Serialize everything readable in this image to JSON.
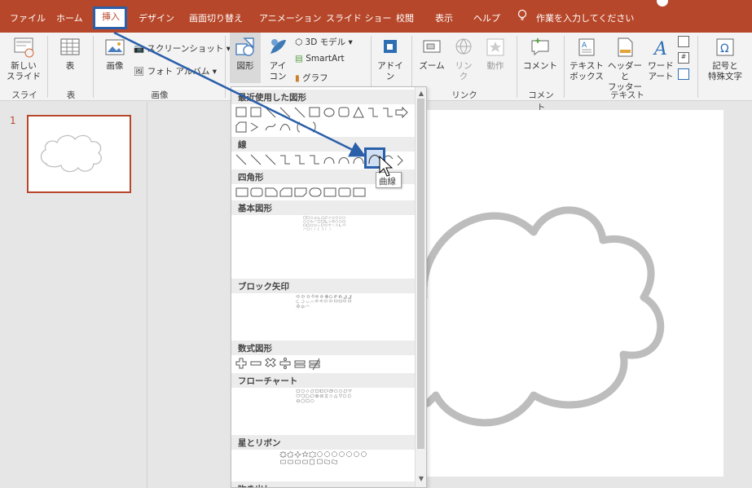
{
  "tabs": [
    {
      "label": "ファイル"
    },
    {
      "label": "ホーム"
    },
    {
      "label": "挿入"
    },
    {
      "label": "デザイン"
    },
    {
      "label": "画面切り替え"
    },
    {
      "label": "アニメーション"
    },
    {
      "label": "スライド ショー"
    },
    {
      "label": "校閲"
    },
    {
      "label": "表示"
    },
    {
      "label": "ヘルプ"
    }
  ],
  "tell_me": "作業を入力してください",
  "ribbon": {
    "new_slide": "新しい\nスライド",
    "table": "表",
    "images": "画像",
    "screenshot": "スクリーンショット",
    "photo_album": "フォト アルバム",
    "shapes": "図形",
    "icons": "アイ\nコン",
    "model3d": "3D モデル",
    "smartart": "SmartArt",
    "chart": "グラフ",
    "addins": "アドイ\nン",
    "zoom": "ズーム",
    "link": "リン\nク",
    "action": "動作",
    "comment": "コメント",
    "textbox": "テキスト\nボックス",
    "header_footer": "ヘッダーと\nフッター",
    "wordart": "ワード\nアート",
    "symbols": "記号と\n特殊文字",
    "groups": {
      "slides": "スライド",
      "tables": "表",
      "images": "画像",
      "links": "リンク",
      "comments": "コメント",
      "text": "テキスト"
    }
  },
  "slide_number": "1",
  "gallery": {
    "categories": [
      "最近使用した図形",
      "線",
      "四角形",
      "基本図形",
      "ブロック矢印",
      "数式図形",
      "フローチャート",
      "星とリボン",
      "吹き出し"
    ]
  },
  "tooltip": "曲線",
  "colors": {
    "accent": "#b7472a",
    "highlight": "#2a5faa"
  }
}
